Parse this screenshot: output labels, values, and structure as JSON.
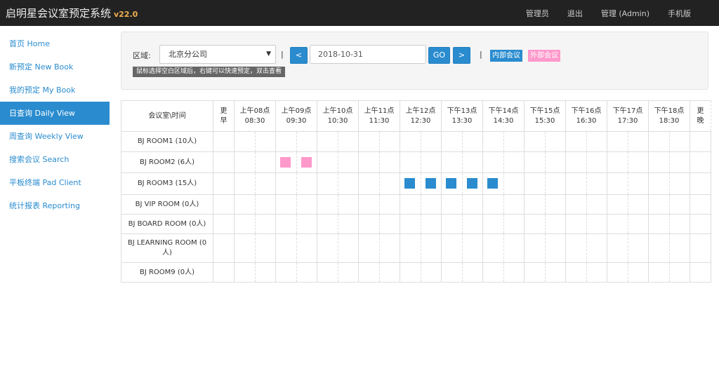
{
  "header": {
    "title": "启明星会议室预定系统",
    "version": "v22.0",
    "links": [
      "管理员",
      "退出",
      "管理 (Admin)",
      "手机版"
    ]
  },
  "sidebar": {
    "items": [
      {
        "label": "首页 Home",
        "active": false
      },
      {
        "label": "新预定 New Book",
        "active": false
      },
      {
        "label": "我的预定 My Book",
        "active": false
      },
      {
        "label": "日查询 Daily View",
        "active": true
      },
      {
        "label": "周查询 Weekly View",
        "active": false
      },
      {
        "label": "搜索会议 Search",
        "active": false
      },
      {
        "label": "平板终端 Pad Client",
        "active": false
      },
      {
        "label": "统计报表 Reporting",
        "active": false
      }
    ]
  },
  "toolbar": {
    "area_label": "区域:",
    "area_value": "北京分公司",
    "separator": "|",
    "prev_label": "<",
    "date_value": "2018-10-31",
    "go_label": "GO",
    "next_label": ">",
    "legend_internal": "内部会议",
    "legend_external": "外部会议",
    "hint": "鼠标选择空白区域后，右键可以快速预定，双击查看"
  },
  "colors": {
    "accent": "#2a8ccf",
    "internal": "#2a8ccf",
    "external": "#ff99cc"
  },
  "grid": {
    "corner": "会议室\\时间",
    "early": [
      "更",
      "早"
    ],
    "late": [
      "更",
      "晚"
    ],
    "hours": [
      {
        "label": "上午08点",
        "time": "08:30"
      },
      {
        "label": "上午09点",
        "time": "09:30"
      },
      {
        "label": "上午10点",
        "time": "10:30"
      },
      {
        "label": "上午11点",
        "time": "11:30"
      },
      {
        "label": "上午12点",
        "time": "12:30"
      },
      {
        "label": "下午13点",
        "time": "13:30"
      },
      {
        "label": "下午14点",
        "time": "14:30"
      },
      {
        "label": "下午15点",
        "time": "15:30"
      },
      {
        "label": "下午16点",
        "time": "16:30"
      },
      {
        "label": "下午17点",
        "time": "17:30"
      },
      {
        "label": "下午18点",
        "time": "18:30"
      }
    ],
    "rooms": [
      {
        "name": "BJ ROOM1 (10人)",
        "bookings": []
      },
      {
        "name": "BJ ROOM2 (6人)",
        "bookings": [
          {
            "slot": 2,
            "kind": "external"
          },
          {
            "slot": 3,
            "kind": "external"
          }
        ]
      },
      {
        "name": "BJ ROOM3 (15人)",
        "bookings": [
          {
            "slot": 8,
            "kind": "internal"
          },
          {
            "slot": 9,
            "kind": "internal"
          },
          {
            "slot": 10,
            "kind": "internal"
          },
          {
            "slot": 11,
            "kind": "internal"
          },
          {
            "slot": 12,
            "kind": "internal"
          }
        ]
      },
      {
        "name": "BJ VIP ROOM (0人)",
        "bookings": []
      },
      {
        "name": "BJ BOARD ROOM (0人)",
        "bookings": []
      },
      {
        "name": "BJ LEARNING ROOM (0人)",
        "bookings": []
      },
      {
        "name": "BJ ROOM9 (0人)",
        "bookings": []
      }
    ]
  }
}
